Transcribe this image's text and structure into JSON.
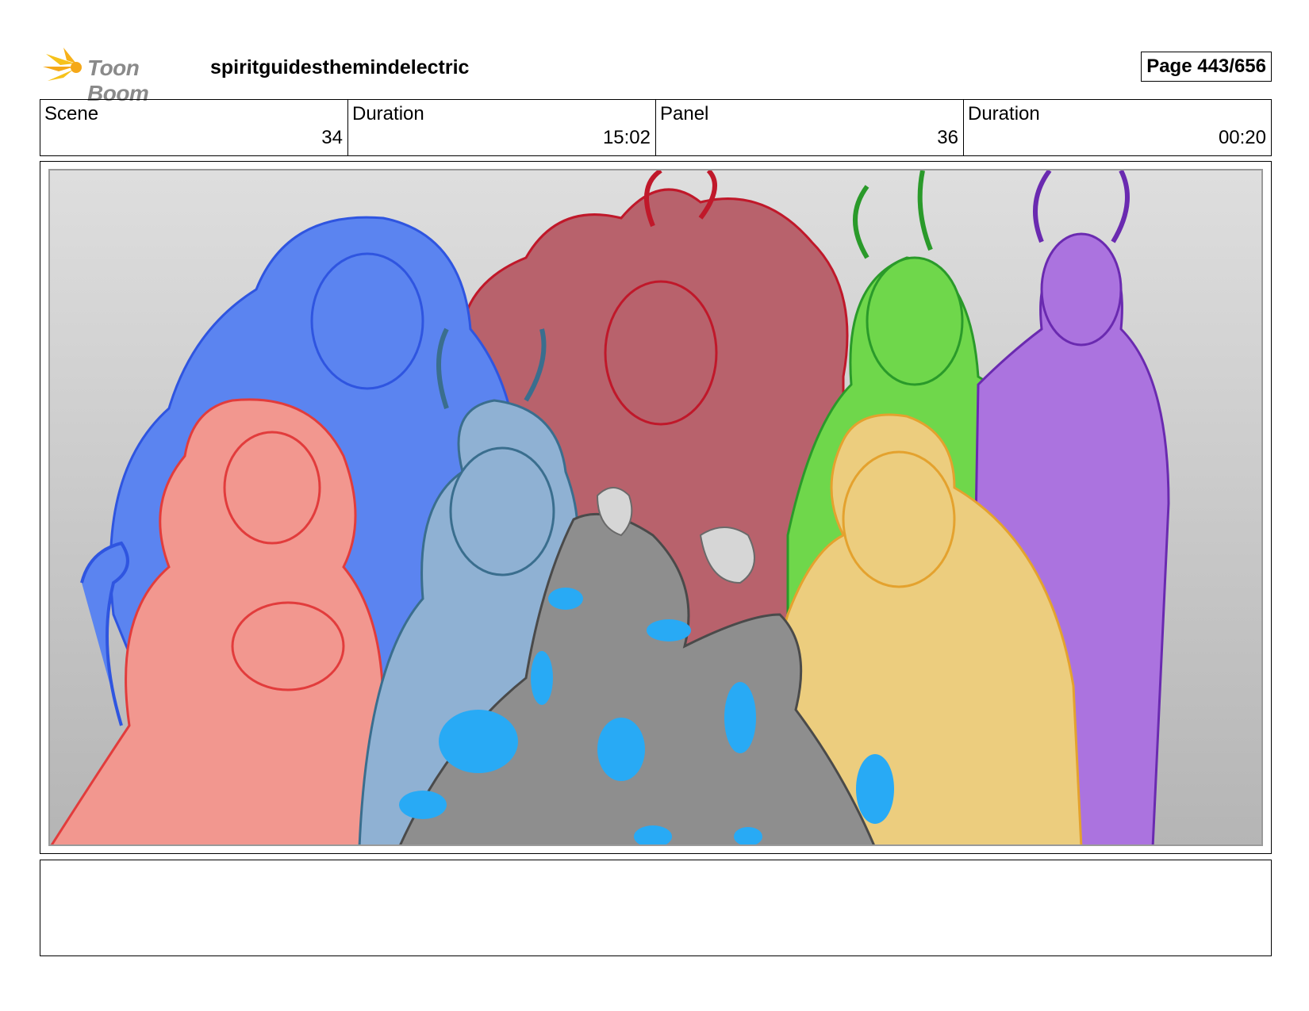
{
  "header": {
    "brand": "Toon Boom",
    "project_title": "spiritguidesthemindelectric",
    "page": "Page 443/656"
  },
  "info": {
    "scene_label": "Scene",
    "scene_value": "34",
    "scene_duration_label": "Duration",
    "scene_duration_value": "15:02",
    "panel_label": "Panel",
    "panel_value": "36",
    "panel_duration_label": "Duration",
    "panel_duration_value": "00:20"
  },
  "colors": {
    "blue": "#5b84f0",
    "pink": "#f2978f",
    "red": "#b8626c",
    "steel": "#8fb1d3",
    "green": "#6fd74b",
    "purple": "#ab73df",
    "yellow": "#eccd7e",
    "gray": "#8e8e8e",
    "water": "#28aaf5"
  },
  "notes": ""
}
